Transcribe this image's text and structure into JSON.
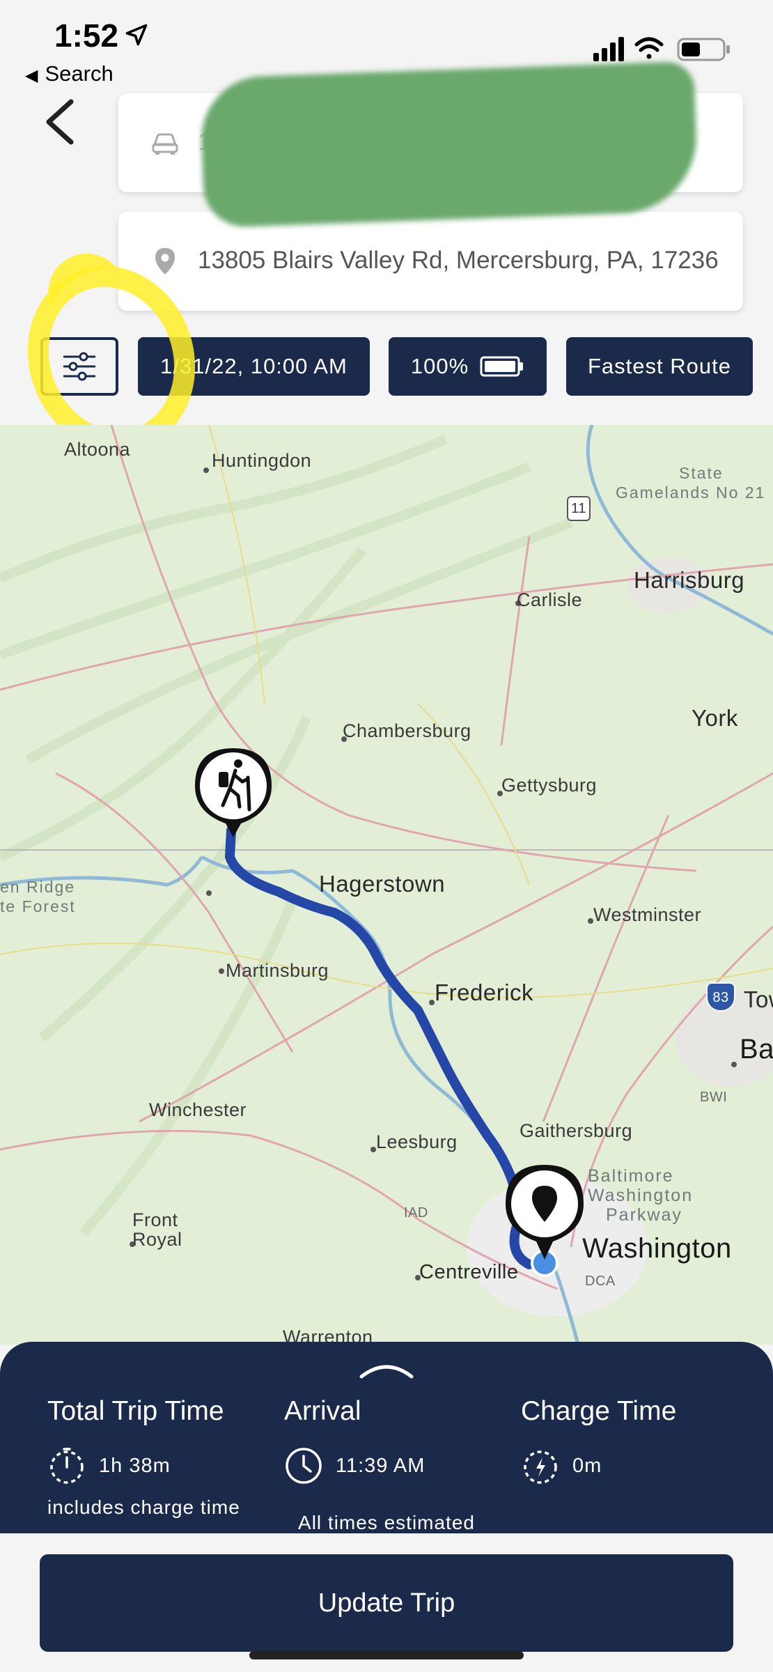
{
  "status_bar": {
    "time": "1:52",
    "back_app_label": "Search"
  },
  "trip_form": {
    "origin": {
      "text": "122"
    },
    "destination": {
      "text": "13805 Blairs Valley Rd, Mercersburg, PA, 17236"
    },
    "options": {
      "departure": "1/31/22, 10:00 AM",
      "battery_level": "100%",
      "route_type": "Fastest Route"
    }
  },
  "map": {
    "labels": {
      "altoona": "Altoona",
      "huntingdon": "Huntingdon",
      "state_gamelands_1": "State",
      "state_gamelands_2": "Gamelands No 21",
      "route_shield": "11",
      "harrisburg": "Harrisburg",
      "carlisle": "Carlisle",
      "york": "York",
      "chambersburg": "Chambersburg",
      "gettysburg": "Gettysburg",
      "green_ridge_1": "en Ridge",
      "green_ridge_2": "te Forest",
      "hagerstown": "Hagerstown",
      "westminster": "Westminster",
      "martinsburg": "Martinsburg",
      "frederick": "Frederick",
      "interstate_shield": "83",
      "towson": "Tow",
      "baltimore": "Ba",
      "bwi": "BWI",
      "winchester": "Winchester",
      "gaithersburg": "Gaithersburg",
      "leesburg": "Leesburg",
      "bw_parkway_1": "Baltimore",
      "bw_parkway_2": "Washington",
      "bw_parkway_3": "Parkway",
      "iad": "IAD",
      "front_royal_1": "Front",
      "front_royal_2": "Royal",
      "washington": "Washington",
      "centreville": "Centreville",
      "dca": "DCA",
      "warrenton": "Warrenton"
    },
    "route_color": "#2547a8"
  },
  "summary": {
    "total_trip_time": {
      "title": "Total Trip Time",
      "value": "1h 38m",
      "note": "includes charge time"
    },
    "arrival": {
      "title": "Arrival",
      "value": "11:39 AM"
    },
    "charge_time": {
      "title": "Charge Time",
      "value": "0m"
    },
    "footnote": "All times estimated"
  },
  "update_button_label": "Update Trip",
  "colors": {
    "primary": "#1b2a4a",
    "highlight": "#ffee28"
  },
  "icons": {
    "origin": "car-icon",
    "destination": "location-pin-icon",
    "settings": "sliders-icon",
    "battery": "battery-icon",
    "total": "stopwatch-icon",
    "arrival": "clock-icon",
    "charge": "charging-timer-icon",
    "start_marker": "hiker-icon",
    "end_marker": "destination-pin-icon"
  }
}
